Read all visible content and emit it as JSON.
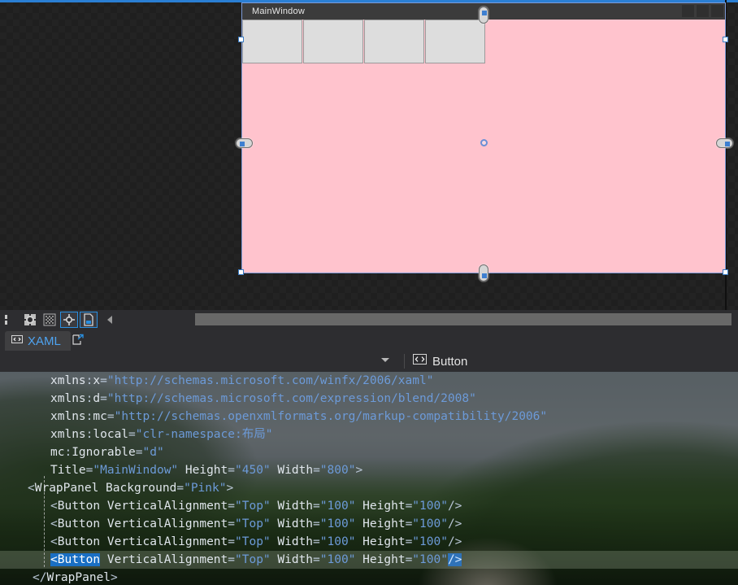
{
  "designer": {
    "window_title": "MainWindow",
    "root_panel": "WrapPanel",
    "panel_background": "Pink",
    "panel_background_hex": "#ffc3cd",
    "button_face_hex": "#dddddd",
    "selection_accent_hex": "#3a7cc4",
    "buttons": [
      {
        "name": "Button",
        "width": "100",
        "height": "100"
      },
      {
        "name": "Button",
        "width": "100",
        "height": "100"
      },
      {
        "name": "Button",
        "width": "100",
        "height": "100"
      },
      {
        "name": "Button",
        "width": "100",
        "height": "100"
      }
    ],
    "caption_buttons": [
      "minimize",
      "maximize",
      "close"
    ],
    "toolbar": {
      "icons": [
        {
          "id": "grid-icon",
          "active": false
        },
        {
          "id": "snap-to-grid-icon",
          "active": false
        },
        {
          "id": "effects-icon",
          "active": false
        },
        {
          "id": "snap-to-guides-icon",
          "active": true
        },
        {
          "id": "artboard-icon",
          "active": true
        }
      ],
      "collapse_icon": "chevron-left-icon",
      "zoom_scrollbar": "horizontal-scrollbar"
    }
  },
  "tabs": {
    "xaml_label": "XAML",
    "xaml_icon": "code-angle-brackets-icon",
    "popout_icon": "pop-out-window-icon"
  },
  "breadcrumb": {
    "dropdown_icon": "chevron-down-icon",
    "element_icon": "code-angle-brackets-icon",
    "element_label": "Button"
  },
  "code": {
    "lines": [
      {
        "indent": "ind0",
        "selected": false,
        "tokens": [
          {
            "t": "xmlns",
            "c": "t-plain"
          },
          {
            "t": ":",
            "c": "t-eq"
          },
          {
            "t": "x",
            "c": "t-plain"
          },
          {
            "t": "=",
            "c": "t-eq"
          },
          {
            "t": "\"http://schemas.microsoft.com/winfx/2006/xaml\"",
            "c": "t-val"
          }
        ]
      },
      {
        "indent": "ind0",
        "selected": false,
        "tokens": [
          {
            "t": "xmlns",
            "c": "t-plain"
          },
          {
            "t": ":",
            "c": "t-eq"
          },
          {
            "t": "d",
            "c": "t-plain"
          },
          {
            "t": "=",
            "c": "t-eq"
          },
          {
            "t": "\"http://schemas.microsoft.com/expression/blend/2008\"",
            "c": "t-val"
          }
        ]
      },
      {
        "indent": "ind0",
        "selected": false,
        "tokens": [
          {
            "t": "xmlns",
            "c": "t-plain"
          },
          {
            "t": ":",
            "c": "t-eq"
          },
          {
            "t": "mc",
            "c": "t-plain"
          },
          {
            "t": "=",
            "c": "t-eq"
          },
          {
            "t": "\"http://schemas.openxmlformats.org/markup-compatibility/2006\"",
            "c": "t-val"
          }
        ]
      },
      {
        "indent": "ind0",
        "selected": false,
        "tokens": [
          {
            "t": "xmlns",
            "c": "t-plain"
          },
          {
            "t": ":",
            "c": "t-eq"
          },
          {
            "t": "local",
            "c": "t-plain"
          },
          {
            "t": "=",
            "c": "t-eq"
          },
          {
            "t": "\"clr-namespace:布局\"",
            "c": "t-val"
          }
        ]
      },
      {
        "indent": "ind0",
        "selected": false,
        "tokens": [
          {
            "t": "mc",
            "c": "t-plain"
          },
          {
            "t": ":",
            "c": "t-eq"
          },
          {
            "t": "Ignorable",
            "c": "t-plain"
          },
          {
            "t": "=",
            "c": "t-eq"
          },
          {
            "t": "\"d\"",
            "c": "t-val"
          }
        ]
      },
      {
        "indent": "ind0",
        "selected": false,
        "tokens": [
          {
            "t": "Title",
            "c": "t-plain"
          },
          {
            "t": "=",
            "c": "t-eq"
          },
          {
            "t": "\"MainWindow\"",
            "c": "t-val"
          },
          {
            "t": " ",
            "c": "t-plain"
          },
          {
            "t": "Height",
            "c": "t-plain"
          },
          {
            "t": "=",
            "c": "t-eq"
          },
          {
            "t": "\"450\"",
            "c": "t-val"
          },
          {
            "t": " ",
            "c": "t-plain"
          },
          {
            "t": "Width",
            "c": "t-plain"
          },
          {
            "t": "=",
            "c": "t-eq"
          },
          {
            "t": "\"800\"",
            "c": "t-val"
          },
          {
            "t": ">",
            "c": "t-tag"
          }
        ]
      },
      {
        "indent": "line-wrap",
        "selected": false,
        "tokens": [
          {
            "t": "<",
            "c": "t-tag"
          },
          {
            "t": "WrapPanel",
            "c": "t-plain"
          },
          {
            "t": " ",
            "c": "t-plain"
          },
          {
            "t": "Background",
            "c": "t-plain"
          },
          {
            "t": "=",
            "c": "t-eq"
          },
          {
            "t": "\"Pink\"",
            "c": "t-val"
          },
          {
            "t": ">",
            "c": "t-tag"
          }
        ]
      },
      {
        "indent": "indb",
        "selected": false,
        "tokens": [
          {
            "t": "<",
            "c": "t-tag"
          },
          {
            "t": "Button",
            "c": "t-plain"
          },
          {
            "t": " ",
            "c": "t-plain"
          },
          {
            "t": "VerticalAlignment",
            "c": "t-plain"
          },
          {
            "t": "=",
            "c": "t-eq"
          },
          {
            "t": "\"Top\"",
            "c": "t-val"
          },
          {
            "t": " ",
            "c": "t-plain"
          },
          {
            "t": "Width",
            "c": "t-plain"
          },
          {
            "t": "=",
            "c": "t-eq"
          },
          {
            "t": "\"100\"",
            "c": "t-val"
          },
          {
            "t": " ",
            "c": "t-plain"
          },
          {
            "t": "Height",
            "c": "t-plain"
          },
          {
            "t": "=",
            "c": "t-eq"
          },
          {
            "t": "\"100\"",
            "c": "t-val"
          },
          {
            "t": "/>",
            "c": "t-tag"
          }
        ]
      },
      {
        "indent": "indb",
        "selected": false,
        "tokens": [
          {
            "t": "<",
            "c": "t-tag"
          },
          {
            "t": "Button",
            "c": "t-plain"
          },
          {
            "t": " ",
            "c": "t-plain"
          },
          {
            "t": "VerticalAlignment",
            "c": "t-plain"
          },
          {
            "t": "=",
            "c": "t-eq"
          },
          {
            "t": "\"Top\"",
            "c": "t-val"
          },
          {
            "t": " ",
            "c": "t-plain"
          },
          {
            "t": "Width",
            "c": "t-plain"
          },
          {
            "t": "=",
            "c": "t-eq"
          },
          {
            "t": "\"100\"",
            "c": "t-val"
          },
          {
            "t": " ",
            "c": "t-plain"
          },
          {
            "t": "Height",
            "c": "t-plain"
          },
          {
            "t": "=",
            "c": "t-eq"
          },
          {
            "t": "\"100\"",
            "c": "t-val"
          },
          {
            "t": "/>",
            "c": "t-tag"
          }
        ]
      },
      {
        "indent": "indb",
        "selected": false,
        "tokens": [
          {
            "t": "<",
            "c": "t-tag"
          },
          {
            "t": "Button",
            "c": "t-plain"
          },
          {
            "t": " ",
            "c": "t-plain"
          },
          {
            "t": "VerticalAlignment",
            "c": "t-plain"
          },
          {
            "t": "=",
            "c": "t-eq"
          },
          {
            "t": "\"Top\"",
            "c": "t-val"
          },
          {
            "t": " ",
            "c": "t-plain"
          },
          {
            "t": "Width",
            "c": "t-plain"
          },
          {
            "t": "=",
            "c": "t-eq"
          },
          {
            "t": "\"100\"",
            "c": "t-val"
          },
          {
            "t": " ",
            "c": "t-plain"
          },
          {
            "t": "Height",
            "c": "t-plain"
          },
          {
            "t": "=",
            "c": "t-eq"
          },
          {
            "t": "\"100\"",
            "c": "t-val"
          },
          {
            "t": "/>",
            "c": "t-tag"
          }
        ]
      },
      {
        "indent": "indb",
        "selected": true,
        "tokens": [
          {
            "t": "<",
            "c": "hl-blue"
          },
          {
            "t": "Button",
            "c": "hl-blue"
          },
          {
            "t": " ",
            "c": "t-plain"
          },
          {
            "t": "VerticalAlignment",
            "c": "t-plain"
          },
          {
            "t": "=",
            "c": "t-eq"
          },
          {
            "t": "\"Top\"",
            "c": "t-val"
          },
          {
            "t": " ",
            "c": "t-plain"
          },
          {
            "t": "Width",
            "c": "t-plain"
          },
          {
            "t": "=",
            "c": "t-eq"
          },
          {
            "t": "\"100\"",
            "c": "t-val"
          },
          {
            "t": " ",
            "c": "t-plain"
          },
          {
            "t": "Height",
            "c": "t-plain"
          },
          {
            "t": "=",
            "c": "t-eq"
          },
          {
            "t": "\"100\"",
            "c": "t-val"
          },
          {
            "t": "/>",
            "c": "hl-soft"
          }
        ]
      },
      {
        "indent": "line-close",
        "selected": false,
        "tokens": [
          {
            "t": "</",
            "c": "t-tag"
          },
          {
            "t": "WrapPanel",
            "c": "t-plain"
          },
          {
            "t": ">",
            "c": "t-tag"
          }
        ]
      }
    ]
  }
}
